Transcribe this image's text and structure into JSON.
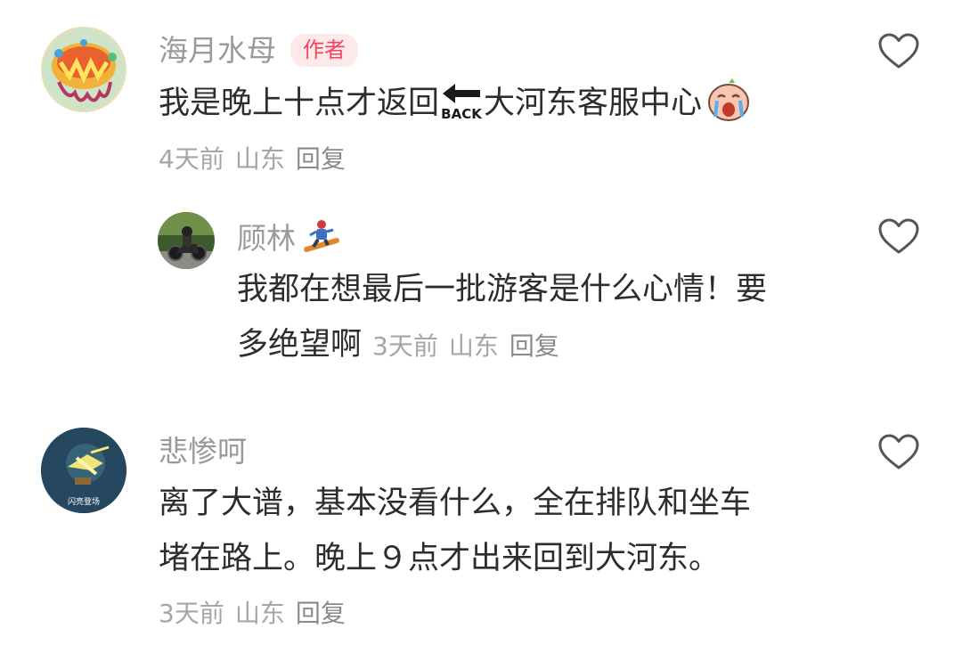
{
  "comments": [
    {
      "username": "海月水母",
      "badge": "作者",
      "text_before": "我是晚上十点才返回",
      "back_label": "BACK",
      "text_after": "大河东客服中心",
      "time": "4天前",
      "location": "山东",
      "reply": "回复",
      "avatar_icon": "jellyfish-illustration-avatar",
      "like_icon": "heart-outline-icon"
    },
    {
      "username": "顾林",
      "name_emoji": "snowboarder-emoji",
      "line1": "我都在想最后一批游客是什么心情！要",
      "line2": "多绝望啊",
      "time": "3天前",
      "location": "山东",
      "reply": "回复",
      "avatar_icon": "motorcycle-rider-avatar",
      "like_icon": "heart-outline-icon"
    },
    {
      "username": "悲惨呵",
      "line1": "离了大谱，基本没看什么，全在排队和坐车",
      "line2": "堵在路上。晚上９点才出来回到大河东。",
      "time": "3天前",
      "location": "山东",
      "reply": "回复",
      "avatar_text": "闪亮登场",
      "avatar_icon": "game-character-avatar",
      "like_icon": "heart-outline-icon"
    }
  ],
  "colors": {
    "username": "#9a9a9a",
    "body_text": "#2d2d2d",
    "meta": "#a6a6a6",
    "badge_bg": "#fde8ea",
    "badge_text": "#ef4560"
  }
}
